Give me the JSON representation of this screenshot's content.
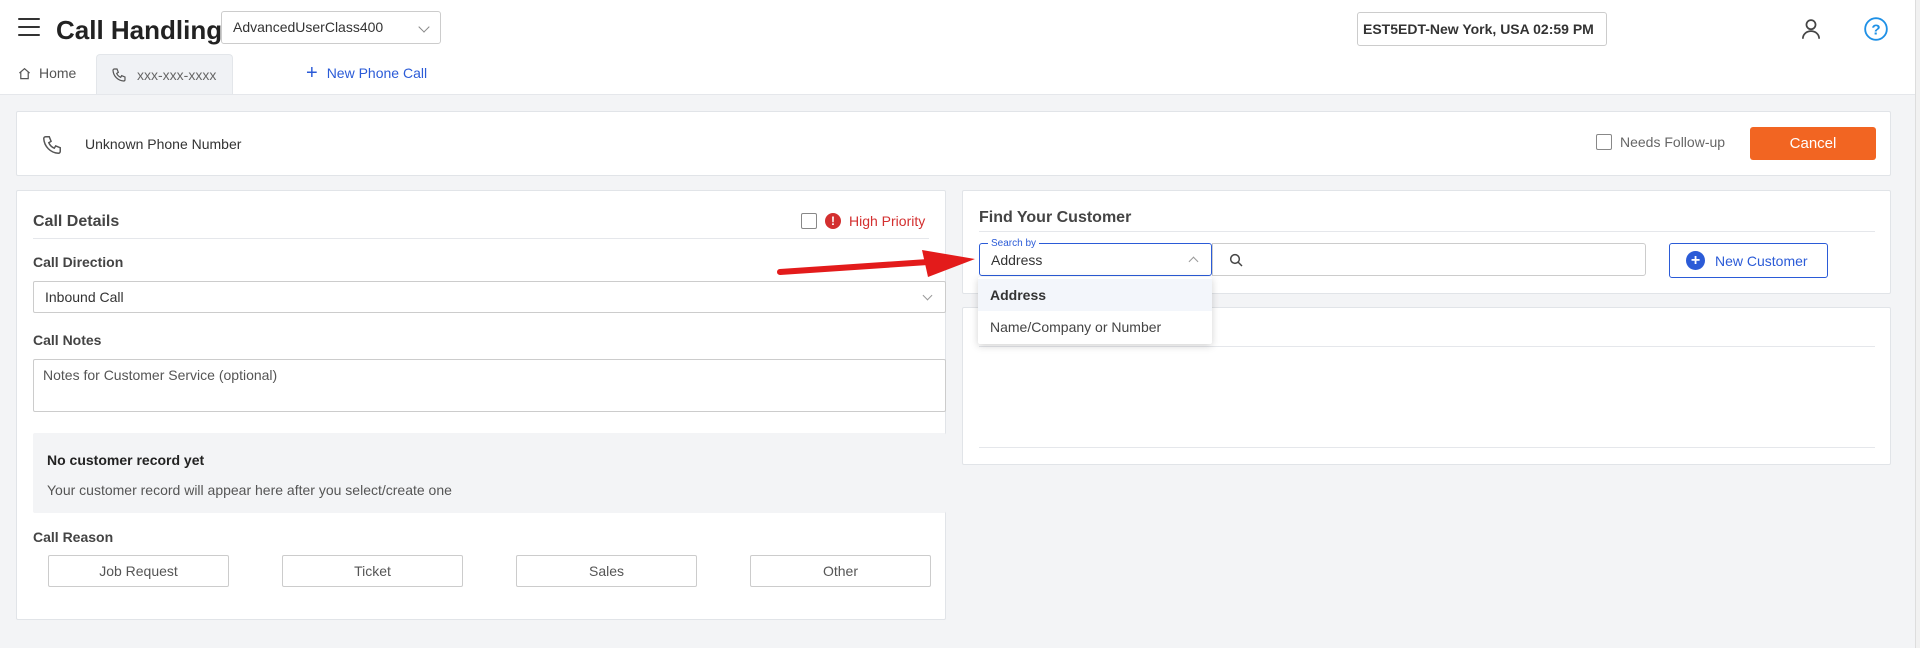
{
  "header": {
    "app_title": "Call Handling",
    "user_class": "AdvancedUserClass400",
    "clock": "EST5EDT-New York, USA 02:59 PM"
  },
  "tabs": [
    {
      "label": "Home",
      "icon": "home-icon"
    },
    {
      "label": "xxx-xxx-xxxx",
      "icon": "phone-icon"
    },
    {
      "label": "New Phone Call",
      "icon": "plus-icon"
    }
  ],
  "call_bar": {
    "phone_label": "Unknown Phone Number",
    "needs_followup_label": "Needs Follow-up",
    "cancel_label": "Cancel"
  },
  "call_details": {
    "title": "Call Details",
    "high_priority_label": "High Priority",
    "direction_label": "Call Direction",
    "direction_value": "Inbound Call",
    "notes_label": "Call Notes",
    "notes_placeholder": "Notes for Customer Service (optional)",
    "no_record_title": "No customer record yet",
    "no_record_text": "Your customer record will appear here after you select/create one",
    "reason_label": "Call Reason",
    "reasons": [
      "Job Request",
      "Ticket",
      "Sales",
      "Other"
    ]
  },
  "find_customer": {
    "title": "Find Your Customer",
    "search_by_legend": "Search by",
    "search_by_value": "Address",
    "search_by_options": [
      "Address",
      "Name/Company or Number"
    ],
    "new_customer_label": "New Customer"
  },
  "colors": {
    "accent_blue": "#2b5bd7",
    "cancel_orange": "#f26522",
    "priority_red": "#d32f2f",
    "annotation_arrow": "#e31b1b"
  }
}
